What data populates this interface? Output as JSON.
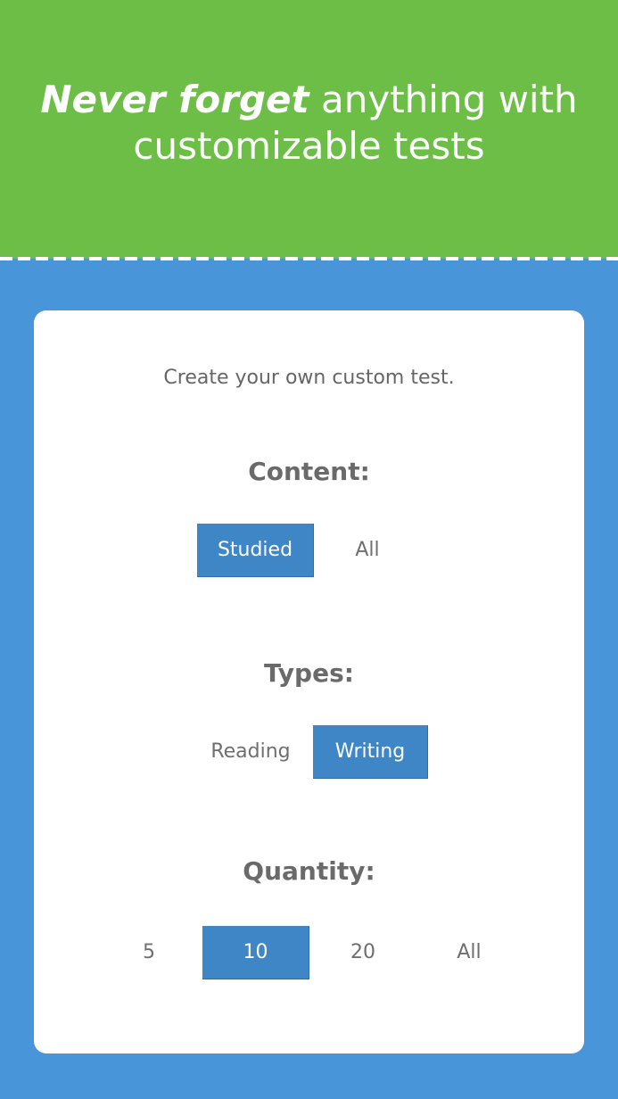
{
  "hero": {
    "title_emphasis": "Never forget",
    "title_rest": " anything with",
    "title_line2": "customizable tests",
    "background_color": "#6dbe47"
  },
  "page": {
    "background_color": "#4896d9"
  },
  "card": {
    "intro": "Create your own custom test.",
    "content": {
      "title": "Content:",
      "options": [
        {
          "label": "Studied",
          "selected": true
        },
        {
          "label": "All",
          "selected": false
        }
      ]
    },
    "types": {
      "title": "Types:",
      "options": [
        {
          "label": "Reading",
          "selected": false
        },
        {
          "label": "Writing",
          "selected": true
        }
      ]
    },
    "quantity": {
      "title": "Quantity:",
      "options": [
        {
          "label": "5",
          "selected": false
        },
        {
          "label": "10",
          "selected": true
        },
        {
          "label": "20",
          "selected": false
        },
        {
          "label": "All",
          "selected": false
        }
      ]
    },
    "selected_color": "#3f86c6"
  }
}
